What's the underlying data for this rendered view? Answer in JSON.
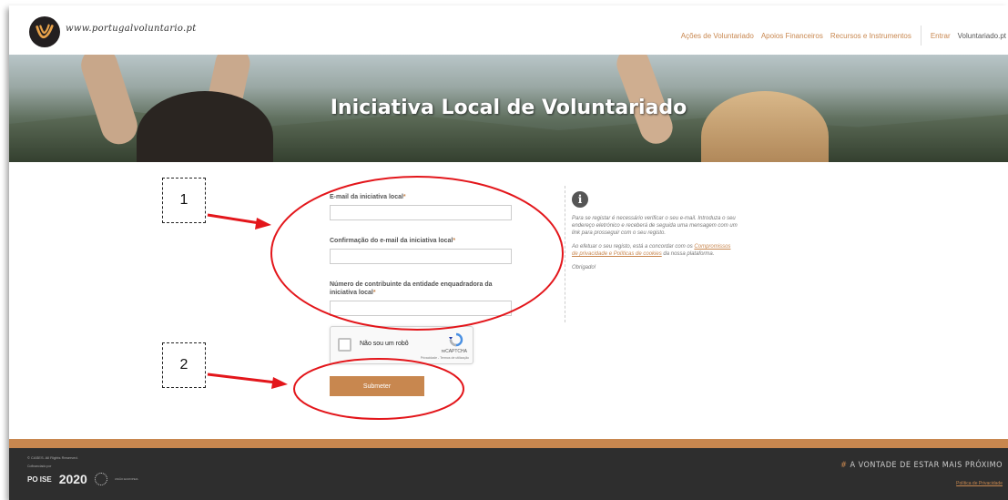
{
  "header": {
    "logo_text": "www.portugalvoluntario.pt",
    "nav": [
      "Ações de Voluntariado",
      "Apoios Financeiros",
      "Recursos e Instrumentos"
    ],
    "login": "Entrar",
    "site_name": "Voluntariado.pt"
  },
  "banner": {
    "title": "Iniciativa Local de Voluntariado"
  },
  "form": {
    "email_label": "E-mail da iniciativa local",
    "email_confirm_label": "Confirmação do e-mail da iniciativa local",
    "nif_label": "Número de contribuinte da entidade enquadradora da iniciativa local",
    "required_mark": "*",
    "email_value": "",
    "email_confirm_value": "",
    "nif_value": "",
    "captcha_label": "Não sou um robô",
    "captcha_brand": "reCAPTCHA",
    "captcha_small": "Privacidade - Termos de utilização",
    "submit_label": "Submeter"
  },
  "info": {
    "p1": "Para se registar é necessário verificar o seu e-mail. Introduza o seu endereço eletrónico e receberá de seguida uma mensagem com um link para prosseguir com o seu registo.",
    "p2_before": "Ao efetuar o seu registo, está a concordar com os ",
    "p2_link": "Compromissos de privacidade e Políticas de cookies",
    "p2_after": " da nossa plataforma.",
    "p3": "Obrigado!"
  },
  "annotations": {
    "label_1": "1",
    "label_2": "2"
  },
  "footer": {
    "copyright": "© CASES. All Rights Reserved.",
    "cofinanced": "Cofinanciado por",
    "poise": "PO ISE",
    "portugal2020": "2020",
    "eu_text": "UNIÃO EUROPEIA",
    "slogan_hash": "#",
    "slogan": "A VONTADE DE ESTAR MAIS PRÓXIMO",
    "privacy": "Política de Privacidade"
  },
  "colors": {
    "accent": "#c8874f",
    "footer_bg": "#2e2e2e",
    "annotation_red": "#e3161b"
  }
}
